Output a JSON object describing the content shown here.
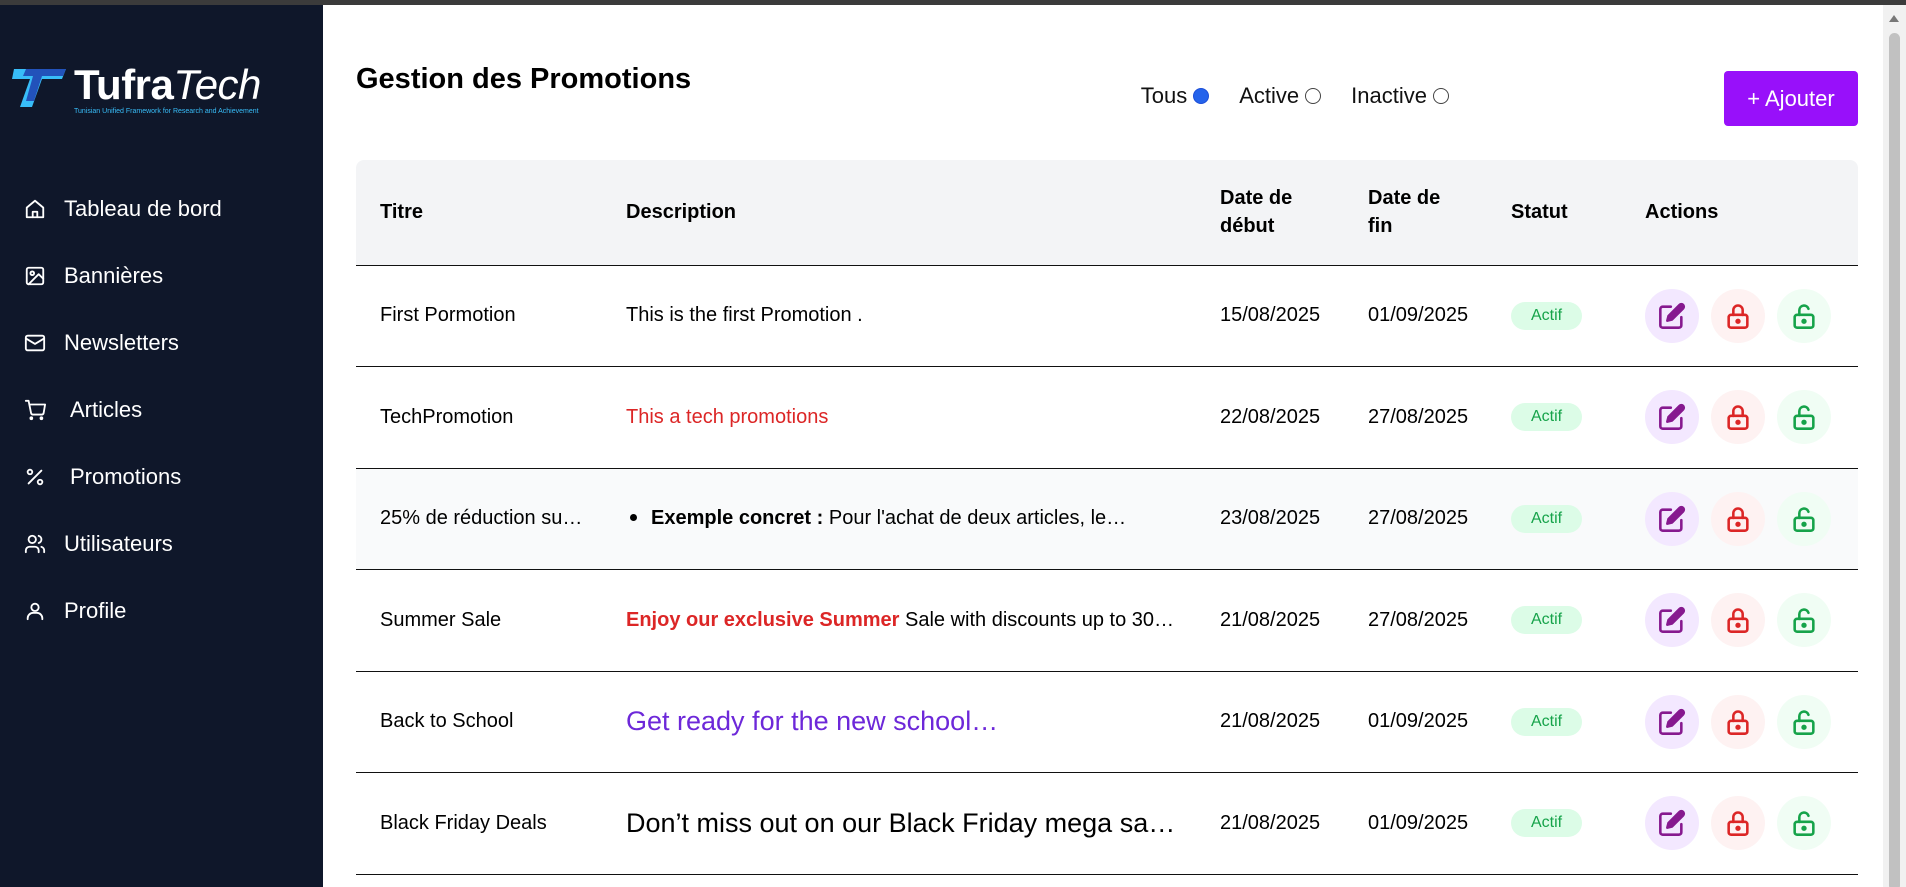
{
  "brand": {
    "name_part1": "Tufra",
    "name_part2": "Tech",
    "tagline": "Tunisian Unified Framework for Research and Achievement",
    "colors": {
      "sidebar_bg": "#0f172a",
      "accent": "#9810fa",
      "active_badge": "#16a34a"
    }
  },
  "sidebar": {
    "items": [
      {
        "label": "Tableau de bord",
        "icon": "home-icon"
      },
      {
        "label": "Bannières",
        "icon": "image-icon"
      },
      {
        "label": "Newsletters",
        "icon": "mail-icon"
      },
      {
        "label": "Articles",
        "icon": "cart-icon"
      },
      {
        "label": "Promotions",
        "icon": "percent-icon"
      },
      {
        "label": "Utilisateurs",
        "icon": "users-icon"
      },
      {
        "label": "Profile",
        "icon": "user-icon"
      }
    ]
  },
  "main": {
    "title": "Gestion des Promotions",
    "filters": [
      {
        "label": "Tous",
        "selected": true
      },
      {
        "label": "Active",
        "selected": false
      },
      {
        "label": "Inactive",
        "selected": false
      }
    ],
    "add_button": "+ Ajouter",
    "table": {
      "headers": {
        "title": "Titre",
        "description": "Description",
        "start_line1": "Date de",
        "start_line2": "début",
        "end_line1": "Date de",
        "end_line2": "fin",
        "status": "Statut",
        "actions": "Actions"
      },
      "rows": [
        {
          "title": "First Pormotion",
          "desc": "This is the first Promotion .",
          "start": "15/08/2025",
          "end": "01/09/2025",
          "status": "Actif"
        },
        {
          "title": "TechPromotion",
          "desc": "This a tech promotions",
          "start": "22/08/2025",
          "end": "27/08/2025",
          "status": "Actif"
        },
        {
          "title": "25% de réduction su…",
          "desc_bold": "Exemple concret :",
          "desc": " Pour l'achat de deux articles, le…",
          "start": "23/08/2025",
          "end": "27/08/2025",
          "status": "Actif"
        },
        {
          "title": "Summer Sale",
          "desc_bold": "Enjoy our exclusive Summer",
          "desc": " Sale with discounts up to 30…",
          "start": "21/08/2025",
          "end": "27/08/2025",
          "status": "Actif"
        },
        {
          "title": "Back to School",
          "desc": "Get ready for the new school…",
          "start": "21/08/2025",
          "end": "01/09/2025",
          "status": "Actif"
        },
        {
          "title": "Black Friday Deals",
          "desc": "Don’t miss out on our Black Friday mega sa…",
          "start": "21/08/2025",
          "end": "01/09/2025",
          "status": "Actif"
        }
      ]
    }
  }
}
